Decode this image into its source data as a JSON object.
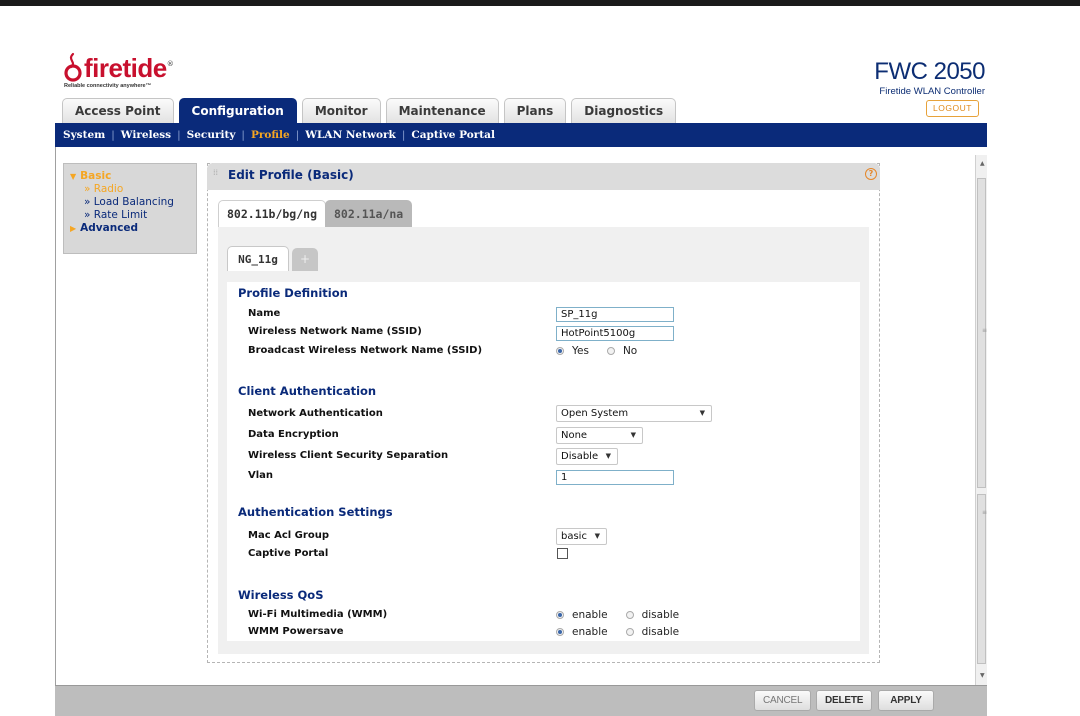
{
  "brand": {
    "name": "firetide",
    "registered": "®",
    "tagline": "Reliable connectivity anywhere™"
  },
  "product": {
    "name": "FWC 2050",
    "subtitle": "Firetide WLAN Controller",
    "logout_label": "LOGOUT"
  },
  "main_tabs": [
    "Access Point",
    "Configuration",
    "Monitor",
    "Maintenance",
    "Plans",
    "Diagnostics"
  ],
  "active_main_tab": "Configuration",
  "sub_nav": [
    "System",
    "Wireless",
    "Security",
    "Profile",
    "WLAN Network",
    "Captive Portal"
  ],
  "active_sub_nav": "Profile",
  "side_menu": {
    "basic": "Basic",
    "radio": "» Radio",
    "load_balancing": "» Load Balancing",
    "rate_limit": "» Rate Limit",
    "advanced": "Advanced"
  },
  "panel": {
    "title": "Edit Profile (Basic)",
    "help_icon": "?",
    "band_tabs": [
      "802.11b/bg/ng",
      "802.11a/na"
    ],
    "profile_tab": "NG_11g",
    "add_tab": "+"
  },
  "form": {
    "profile_definition": {
      "title": "Profile Definition",
      "name_label": "Name",
      "name_value": "SP_11g",
      "ssid_label": "Wireless Network Name (SSID)",
      "ssid_value": "HotPoint5100g",
      "broadcast_label": "Broadcast Wireless Network Name (SSID)",
      "broadcast_yes": "Yes",
      "broadcast_no": "No",
      "broadcast_selected": "Yes"
    },
    "client_auth": {
      "title": "Client Authentication",
      "network_auth_label": "Network Authentication",
      "network_auth_value": "Open System",
      "data_enc_label": "Data Encryption",
      "data_enc_value": "None",
      "separation_label": "Wireless Client Security Separation",
      "separation_value": "Disable",
      "vlan_label": "Vlan",
      "vlan_value": "1"
    },
    "auth_settings": {
      "title": "Authentication Settings",
      "mac_acl_label": "Mac Acl Group",
      "mac_acl_value": "basic",
      "captive_portal_label": "Captive Portal",
      "captive_portal_checked": false
    },
    "wireless_qos": {
      "title": "Wireless QoS",
      "wmm_label": "Wi-Fi Multimedia (WMM)",
      "wmm_enable": "enable",
      "wmm_disable": "disable",
      "wmm_selected": "enable",
      "powersave_label": "WMM Powersave",
      "powersave_enable": "enable",
      "powersave_disable": "disable",
      "powersave_selected": "enable"
    }
  },
  "buttons": {
    "cancel": "CANCEL",
    "delete": "DELETE",
    "apply": "APPLY"
  },
  "colors": {
    "nav_blue": "#0a2a7a",
    "accent_orange": "#f5a623",
    "brand_red": "#c8102e"
  }
}
